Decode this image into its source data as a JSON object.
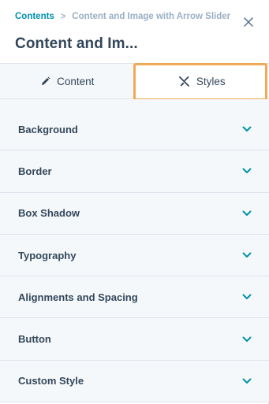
{
  "breadcrumb": {
    "link": "Contents",
    "separator": ">",
    "current": "Content and Image with Arrow Slider"
  },
  "title": "Content and Im...",
  "tabs": [
    {
      "label": "Content",
      "icon": "pencil-icon",
      "active": false
    },
    {
      "label": "Styles",
      "icon": "brush-icon",
      "active": true
    }
  ],
  "sections": [
    {
      "label": "Background"
    },
    {
      "label": "Border"
    },
    {
      "label": "Box Shadow"
    },
    {
      "label": "Typography"
    },
    {
      "label": "Alignments and Spacing"
    },
    {
      "label": "Button"
    },
    {
      "label": "Custom Style"
    }
  ],
  "colors": {
    "accent": "#0091ae",
    "text": "#33475b",
    "muted": "#99afc4",
    "highlight": "#f0a957",
    "panel_bg": "#f5f8fa"
  }
}
